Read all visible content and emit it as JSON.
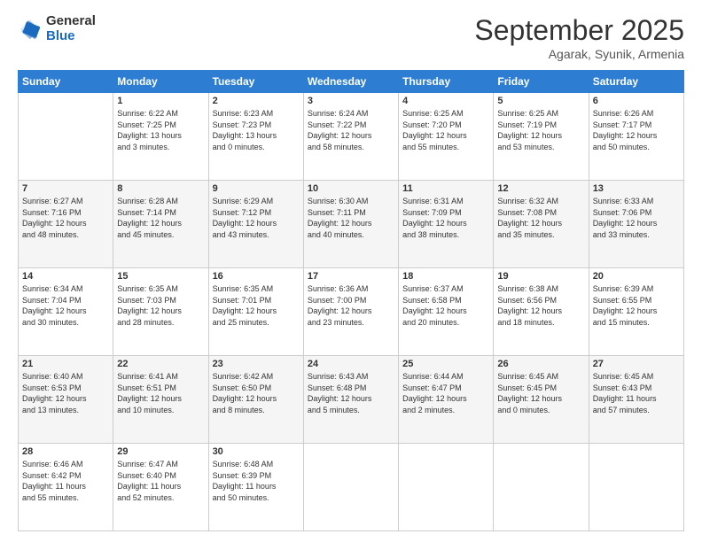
{
  "logo": {
    "general": "General",
    "blue": "Blue"
  },
  "header": {
    "month": "September 2025",
    "location": "Agarak, Syunik, Armenia"
  },
  "days_of_week": [
    "Sunday",
    "Monday",
    "Tuesday",
    "Wednesday",
    "Thursday",
    "Friday",
    "Saturday"
  ],
  "weeks": [
    [
      {
        "day": "",
        "info": ""
      },
      {
        "day": "1",
        "info": "Sunrise: 6:22 AM\nSunset: 7:25 PM\nDaylight: 13 hours\nand 3 minutes."
      },
      {
        "day": "2",
        "info": "Sunrise: 6:23 AM\nSunset: 7:23 PM\nDaylight: 13 hours\nand 0 minutes."
      },
      {
        "day": "3",
        "info": "Sunrise: 6:24 AM\nSunset: 7:22 PM\nDaylight: 12 hours\nand 58 minutes."
      },
      {
        "day": "4",
        "info": "Sunrise: 6:25 AM\nSunset: 7:20 PM\nDaylight: 12 hours\nand 55 minutes."
      },
      {
        "day": "5",
        "info": "Sunrise: 6:25 AM\nSunset: 7:19 PM\nDaylight: 12 hours\nand 53 minutes."
      },
      {
        "day": "6",
        "info": "Sunrise: 6:26 AM\nSunset: 7:17 PM\nDaylight: 12 hours\nand 50 minutes."
      }
    ],
    [
      {
        "day": "7",
        "info": "Sunrise: 6:27 AM\nSunset: 7:16 PM\nDaylight: 12 hours\nand 48 minutes."
      },
      {
        "day": "8",
        "info": "Sunrise: 6:28 AM\nSunset: 7:14 PM\nDaylight: 12 hours\nand 45 minutes."
      },
      {
        "day": "9",
        "info": "Sunrise: 6:29 AM\nSunset: 7:12 PM\nDaylight: 12 hours\nand 43 minutes."
      },
      {
        "day": "10",
        "info": "Sunrise: 6:30 AM\nSunset: 7:11 PM\nDaylight: 12 hours\nand 40 minutes."
      },
      {
        "day": "11",
        "info": "Sunrise: 6:31 AM\nSunset: 7:09 PM\nDaylight: 12 hours\nand 38 minutes."
      },
      {
        "day": "12",
        "info": "Sunrise: 6:32 AM\nSunset: 7:08 PM\nDaylight: 12 hours\nand 35 minutes."
      },
      {
        "day": "13",
        "info": "Sunrise: 6:33 AM\nSunset: 7:06 PM\nDaylight: 12 hours\nand 33 minutes."
      }
    ],
    [
      {
        "day": "14",
        "info": "Sunrise: 6:34 AM\nSunset: 7:04 PM\nDaylight: 12 hours\nand 30 minutes."
      },
      {
        "day": "15",
        "info": "Sunrise: 6:35 AM\nSunset: 7:03 PM\nDaylight: 12 hours\nand 28 minutes."
      },
      {
        "day": "16",
        "info": "Sunrise: 6:35 AM\nSunset: 7:01 PM\nDaylight: 12 hours\nand 25 minutes."
      },
      {
        "day": "17",
        "info": "Sunrise: 6:36 AM\nSunset: 7:00 PM\nDaylight: 12 hours\nand 23 minutes."
      },
      {
        "day": "18",
        "info": "Sunrise: 6:37 AM\nSunset: 6:58 PM\nDaylight: 12 hours\nand 20 minutes."
      },
      {
        "day": "19",
        "info": "Sunrise: 6:38 AM\nSunset: 6:56 PM\nDaylight: 12 hours\nand 18 minutes."
      },
      {
        "day": "20",
        "info": "Sunrise: 6:39 AM\nSunset: 6:55 PM\nDaylight: 12 hours\nand 15 minutes."
      }
    ],
    [
      {
        "day": "21",
        "info": "Sunrise: 6:40 AM\nSunset: 6:53 PM\nDaylight: 12 hours\nand 13 minutes."
      },
      {
        "day": "22",
        "info": "Sunrise: 6:41 AM\nSunset: 6:51 PM\nDaylight: 12 hours\nand 10 minutes."
      },
      {
        "day": "23",
        "info": "Sunrise: 6:42 AM\nSunset: 6:50 PM\nDaylight: 12 hours\nand 8 minutes."
      },
      {
        "day": "24",
        "info": "Sunrise: 6:43 AM\nSunset: 6:48 PM\nDaylight: 12 hours\nand 5 minutes."
      },
      {
        "day": "25",
        "info": "Sunrise: 6:44 AM\nSunset: 6:47 PM\nDaylight: 12 hours\nand 2 minutes."
      },
      {
        "day": "26",
        "info": "Sunrise: 6:45 AM\nSunset: 6:45 PM\nDaylight: 12 hours\nand 0 minutes."
      },
      {
        "day": "27",
        "info": "Sunrise: 6:45 AM\nSunset: 6:43 PM\nDaylight: 11 hours\nand 57 minutes."
      }
    ],
    [
      {
        "day": "28",
        "info": "Sunrise: 6:46 AM\nSunset: 6:42 PM\nDaylight: 11 hours\nand 55 minutes."
      },
      {
        "day": "29",
        "info": "Sunrise: 6:47 AM\nSunset: 6:40 PM\nDaylight: 11 hours\nand 52 minutes."
      },
      {
        "day": "30",
        "info": "Sunrise: 6:48 AM\nSunset: 6:39 PM\nDaylight: 11 hours\nand 50 minutes."
      },
      {
        "day": "",
        "info": ""
      },
      {
        "day": "",
        "info": ""
      },
      {
        "day": "",
        "info": ""
      },
      {
        "day": "",
        "info": ""
      }
    ]
  ]
}
